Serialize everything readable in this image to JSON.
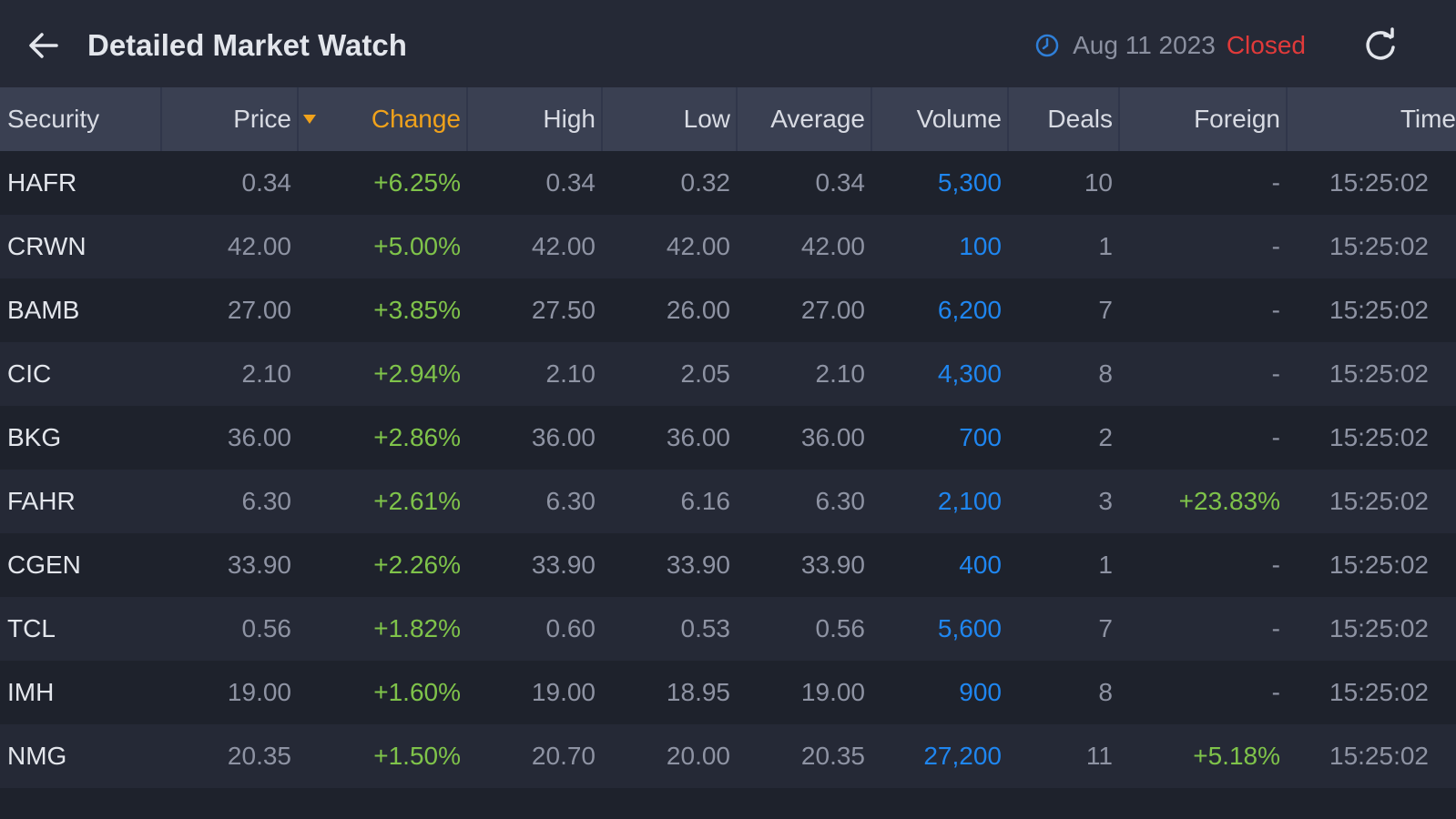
{
  "header": {
    "title": "Detailed Market Watch",
    "date": "Aug 11 2023",
    "status": "Closed",
    "status_color": "#e03a3a",
    "back_icon": "arrow-left-icon",
    "clock_icon": "clock-icon",
    "refresh_icon": "refresh-icon"
  },
  "table": {
    "sorted_by": "Change",
    "sort_direction": "descending",
    "accent_color": "#f0a21b",
    "columns": [
      "Security",
      "Price",
      "Change",
      "High",
      "Low",
      "Average",
      "Volume",
      "Deals",
      "Foreign",
      "Time"
    ],
    "rows": [
      {
        "security": "HAFR",
        "price": "0.34",
        "change": "+6.25%",
        "high": "0.34",
        "low": "0.32",
        "average": "0.34",
        "volume": "5,300",
        "deals": "10",
        "foreign": "-",
        "time": "15:25:02"
      },
      {
        "security": "CRWN",
        "price": "42.00",
        "change": "+5.00%",
        "high": "42.00",
        "low": "42.00",
        "average": "42.00",
        "volume": "100",
        "deals": "1",
        "foreign": "-",
        "time": "15:25:02"
      },
      {
        "security": "BAMB",
        "price": "27.00",
        "change": "+3.85%",
        "high": "27.50",
        "low": "26.00",
        "average": "27.00",
        "volume": "6,200",
        "deals": "7",
        "foreign": "-",
        "time": "15:25:02"
      },
      {
        "security": "CIC",
        "price": "2.10",
        "change": "+2.94%",
        "high": "2.10",
        "low": "2.05",
        "average": "2.10",
        "volume": "4,300",
        "deals": "8",
        "foreign": "-",
        "time": "15:25:02"
      },
      {
        "security": "BKG",
        "price": "36.00",
        "change": "+2.86%",
        "high": "36.00",
        "low": "36.00",
        "average": "36.00",
        "volume": "700",
        "deals": "2",
        "foreign": "-",
        "time": "15:25:02"
      },
      {
        "security": "FAHR",
        "price": "6.30",
        "change": "+2.61%",
        "high": "6.30",
        "low": "6.16",
        "average": "6.30",
        "volume": "2,100",
        "deals": "3",
        "foreign": "+23.83%",
        "time": "15:25:02"
      },
      {
        "security": "CGEN",
        "price": "33.90",
        "change": "+2.26%",
        "high": "33.90",
        "low": "33.90",
        "average": "33.90",
        "volume": "400",
        "deals": "1",
        "foreign": "-",
        "time": "15:25:02"
      },
      {
        "security": "TCL",
        "price": "0.56",
        "change": "+1.82%",
        "high": "0.60",
        "low": "0.53",
        "average": "0.56",
        "volume": "5,600",
        "deals": "7",
        "foreign": "-",
        "time": "15:25:02"
      },
      {
        "security": "IMH",
        "price": "19.00",
        "change": "+1.60%",
        "high": "19.00",
        "low": "18.95",
        "average": "19.00",
        "volume": "900",
        "deals": "8",
        "foreign": "-",
        "time": "15:25:02"
      },
      {
        "security": "NMG",
        "price": "20.35",
        "change": "+1.50%",
        "high": "20.70",
        "low": "20.00",
        "average": "20.35",
        "volume": "27,200",
        "deals": "11",
        "foreign": "+5.18%",
        "time": "15:25:02"
      }
    ]
  }
}
